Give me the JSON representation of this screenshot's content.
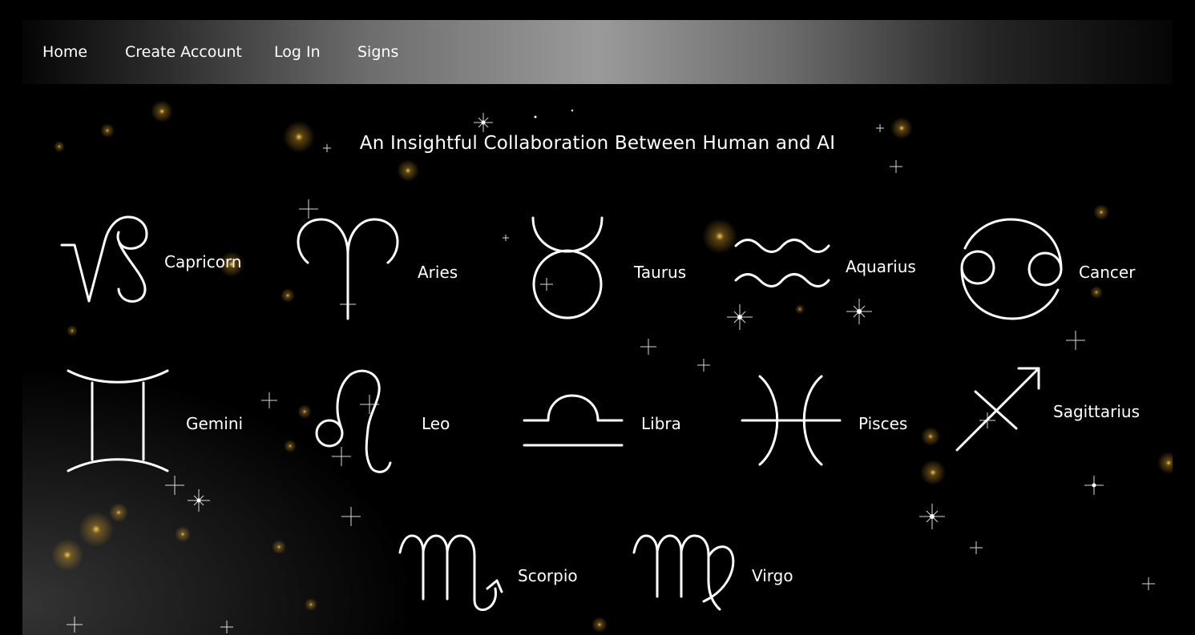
{
  "nav": {
    "items": [
      {
        "label": "Home"
      },
      {
        "label": "Create Account"
      },
      {
        "label": "Log In"
      },
      {
        "label": "Signs"
      }
    ]
  },
  "title": "An Insightful Collaboration Between Human and AI",
  "signs": [
    {
      "name": "Capricorn",
      "icon": "capricorn-icon"
    },
    {
      "name": "Aries",
      "icon": "aries-icon"
    },
    {
      "name": "Taurus",
      "icon": "taurus-icon"
    },
    {
      "name": "Aquarius",
      "icon": "aquarius-icon"
    },
    {
      "name": "Cancer",
      "icon": "cancer-icon"
    },
    {
      "name": "Gemini",
      "icon": "gemini-icon"
    },
    {
      "name": "Leo",
      "icon": "leo-icon"
    },
    {
      "name": "Libra",
      "icon": "libra-icon"
    },
    {
      "name": "Pisces",
      "icon": "pisces-icon"
    },
    {
      "name": "Sagittarius",
      "icon": "sagittarius-icon"
    },
    {
      "name": "Scorpio",
      "icon": "scorpio-icon"
    },
    {
      "name": "Virgo",
      "icon": "virgo-icon"
    }
  ],
  "colors": {
    "background": "#000000",
    "text": "#ffffff",
    "nav_highlight": "#9a9a9a",
    "star_gold": "#f0c040"
  }
}
